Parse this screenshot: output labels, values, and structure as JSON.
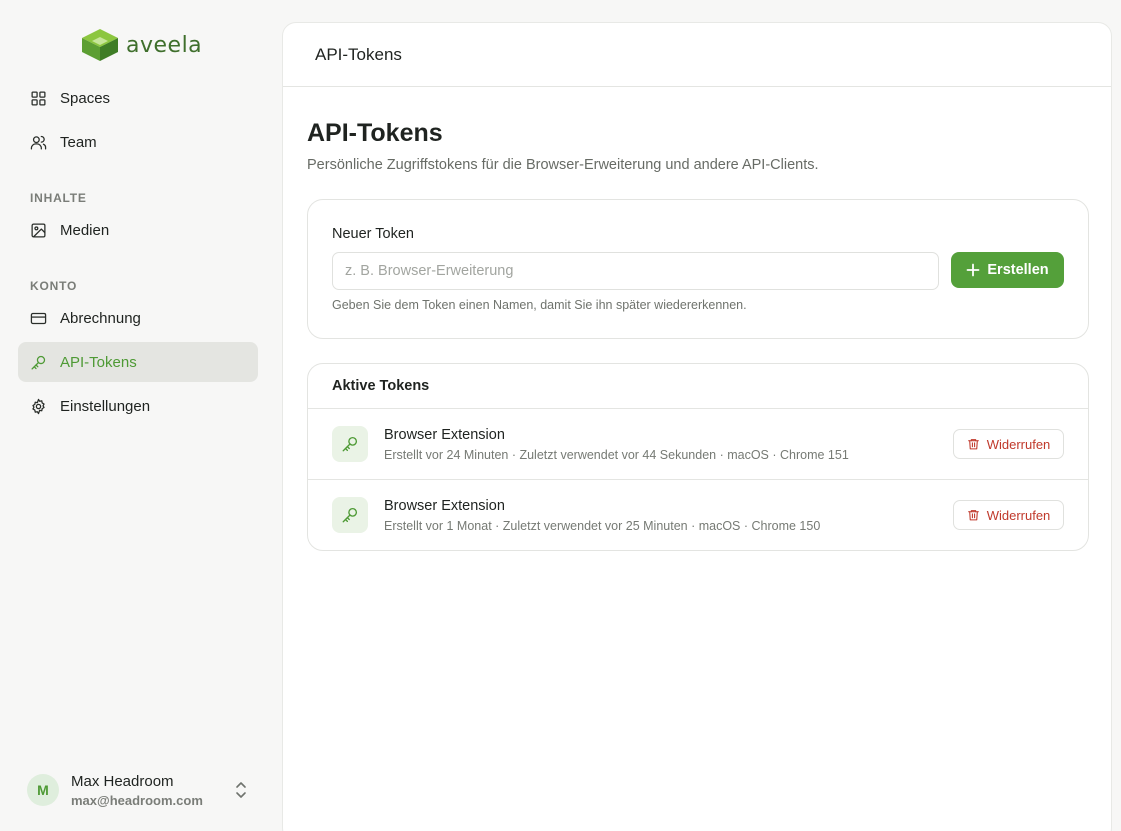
{
  "colors": {
    "accent": "#54a03a",
    "accent_text": "#4e9a35",
    "danger": "#c0392b"
  },
  "logo": {
    "text": "aveela"
  },
  "nav": {
    "spaces": "Spaces",
    "team": "Team",
    "section_inhalte": "INHALTE",
    "medien": "Medien",
    "section_konto": "KONTO",
    "abrechnung": "Abrechnung",
    "api_tokens": "API-Tokens",
    "einstellungen": "Einstellungen"
  },
  "user": {
    "initial": "M",
    "name": "Max Headroom",
    "email": "max@headroom.com"
  },
  "header": {
    "title": "API-Tokens"
  },
  "page": {
    "title": "API-Tokens",
    "subtitle": "Persönliche Zugriffstokens für die Browser-Erweiterung und andere API-Clients."
  },
  "new_token": {
    "label": "Neuer Token",
    "placeholder": "z. B. Browser-Erweiterung",
    "value": "",
    "button": "Erstellen",
    "hint": "Geben Sie dem Token einen Namen, damit Sie ihn später wiedererkennen."
  },
  "active_tokens": {
    "title": "Aktive Tokens",
    "revoke_label": "Widerrufen",
    "items": [
      {
        "name": "Browser Extension",
        "meta": "Erstellt vor 24 Minuten · Zuletzt verwendet vor 44 Sekunden · macOS · Chrome 151"
      },
      {
        "name": "Browser Extension",
        "meta": "Erstellt vor 1 Monat · Zuletzt verwendet vor 25 Minuten · macOS · Chrome 150"
      }
    ]
  }
}
